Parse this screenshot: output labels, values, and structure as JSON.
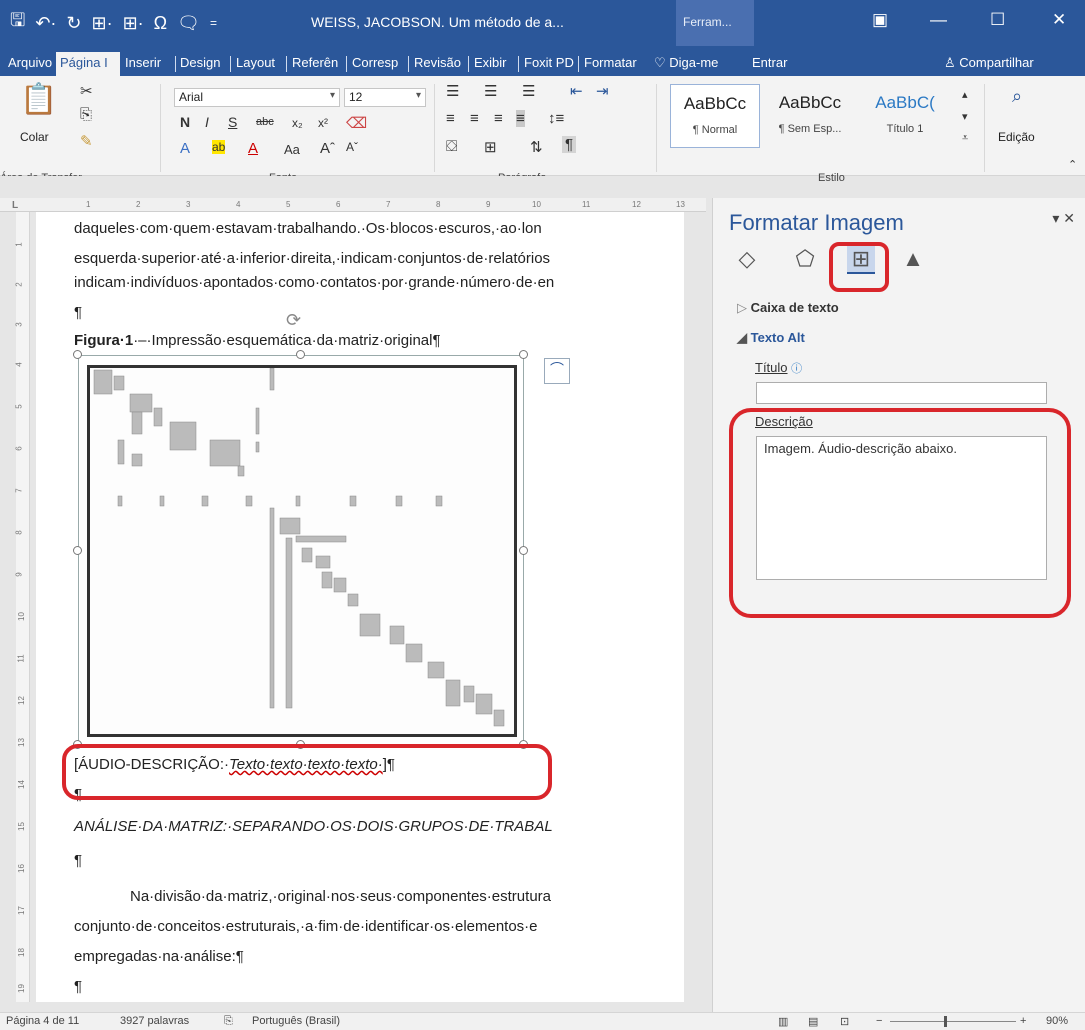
{
  "window": {
    "title": "WEISS, JACOBSON. Um método de a...",
    "context_tab": "Ferram..."
  },
  "tabs": [
    "Arquivo",
    "Página I",
    "Inserir",
    "Design",
    "Layout",
    "Referên",
    "Corresp",
    "Revisão",
    "Exibir",
    "Foxit PD",
    "Formatar"
  ],
  "tell_me": "Diga-me",
  "sign_in": "Entrar",
  "share": "Compartilhar",
  "ribbon": {
    "clipboard": {
      "paste": "Colar",
      "group": "Área de Transfer..."
    },
    "font": {
      "name": "Arial",
      "size": "12",
      "group": "Fonte",
      "change_case": "Aa"
    },
    "paragraph": {
      "group": "Parágrafo"
    },
    "styles": {
      "group": "Estilo",
      "items": [
        {
          "sample": "AaBbCc",
          "name": "¶ Normal"
        },
        {
          "sample": "AaBbCc",
          "name": "¶ Sem Esp..."
        },
        {
          "sample": "AaBbC(",
          "name": "Título 1"
        }
      ]
    },
    "editing": {
      "label": "Edição"
    }
  },
  "ruler": {
    "h_numbers": [
      "1",
      "2",
      "3",
      "4",
      "5",
      "6",
      "7",
      "8",
      "9",
      "10",
      "11",
      "12",
      "13"
    ],
    "v_numbers": [
      "1",
      "2",
      "3",
      "4",
      "5",
      "6",
      "7",
      "8",
      "9",
      "10",
      "11",
      "12",
      "13",
      "14",
      "15",
      "16",
      "17",
      "18",
      "19"
    ]
  },
  "document": {
    "line1": "daqueles·com·quem·estavam·trabalhando.·Os·blocos·escuros,·ao·lon",
    "line2": "esquerda·superior·até·a·inferior·direita,·indicam·conjuntos·de·relatórios",
    "line3": "indicam·indivíduos·apontados·como·contatos·por·grande·número·de·en",
    "pilcrow": "¶",
    "figure_label": "Figura·1",
    "figure_caption": "·–·Impressão·esquemática·da·matriz·original¶",
    "audio_prefix": "[ÁUDIO-DESCRIÇÃO:·",
    "audio_text": "Texto·texto·texto·texto·",
    "audio_suffix": "]¶",
    "heading": "ANÁLISE·DA·MATRIZ:·SEPARANDO·OS·DOIS·GRUPOS·DE·TRABAL",
    "para1": "Na·divisão·da·matriz,·original·nos·seus·componentes·estrutura",
    "para2": "conjunto·de·conceitos·estruturais,·a·fim·de·identificar·os·elementos·e",
    "para3": "empregadas·na·análise:¶"
  },
  "pane": {
    "title": "Formatar Imagem",
    "section1": "Caixa de texto",
    "section2": "Texto Alt",
    "title_label": "Título",
    "desc_label": "Descrição",
    "desc_value": "Imagem. Áudio-descrição abaixo.",
    "title_value": ""
  },
  "status": {
    "page": "Página 4 de 11",
    "words": "3927 palavras",
    "language": "Português (Brasil)",
    "zoom": "90%"
  },
  "colors": {
    "accent": "#2b579a",
    "highlight": "#d9262b"
  }
}
